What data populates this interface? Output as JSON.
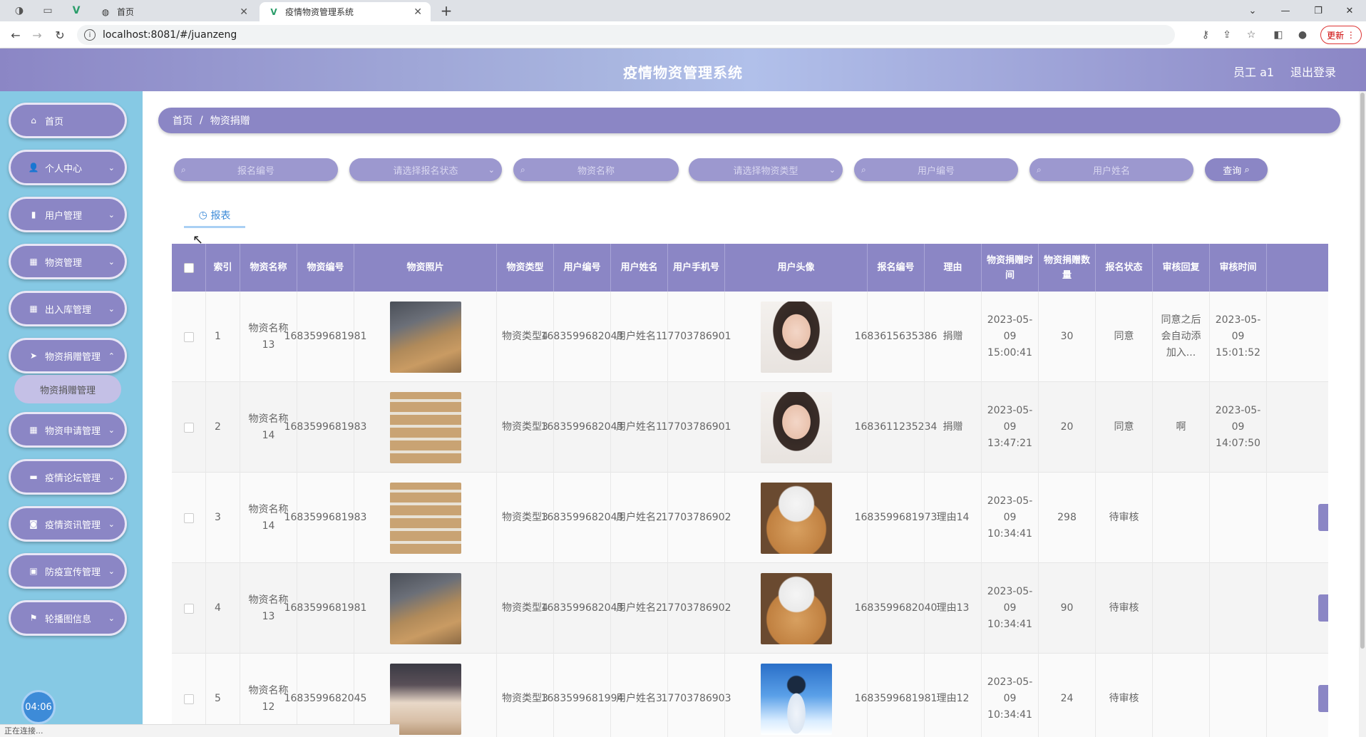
{
  "browser": {
    "tabs": [
      {
        "title": "首页",
        "active": false
      },
      {
        "title": "疫情物资管理系统",
        "active": true
      }
    ],
    "url": "localhost:8081/#/juanzeng",
    "update_label": "更新"
  },
  "header": {
    "title": "疫情物资管理系统",
    "user": "员工 a1",
    "logout": "退出登录"
  },
  "sidebar": {
    "items": [
      {
        "label": "首页",
        "icon": "home-icon"
      },
      {
        "label": "个人中心",
        "icon": "user-icon"
      },
      {
        "label": "用户管理",
        "icon": "chart-icon"
      },
      {
        "label": "物资管理",
        "icon": "grid-icon"
      },
      {
        "label": "出入库管理",
        "icon": "grid-icon"
      },
      {
        "label": "物资捐赠管理",
        "icon": "send-icon"
      },
      {
        "label": "物资申请管理",
        "icon": "grid-icon"
      },
      {
        "label": "疫情论坛管理",
        "icon": "tablet-icon"
      },
      {
        "label": "疫情资讯管理",
        "icon": "camera-icon"
      },
      {
        "label": "防疫宣传管理",
        "icon": "inbox-icon"
      },
      {
        "label": "轮播图信息",
        "icon": "flag-icon"
      }
    ],
    "submenu_label": "物资捐赠管理",
    "timer": "04:06"
  },
  "breadcrumb": {
    "home": "首页",
    "sep": "/",
    "current": "物资捐赠"
  },
  "filters": {
    "baoming_no": "报名编号",
    "baoming_status": "请选择报名状态",
    "wuzi_name": "物资名称",
    "wuzi_type": "请选择物资类型",
    "user_no": "用户编号",
    "user_name": "用户姓名",
    "query": "查询"
  },
  "report_tab": "报表",
  "table": {
    "headers": [
      "索引",
      "物资名称",
      "物资编号",
      "物资照片",
      "物资类型",
      "用户编号",
      "用户姓名",
      "用户手机号",
      "用户头像",
      "报名编号",
      "理由",
      "物资捐赠时间",
      "物资捐赠数量",
      "报名状态",
      "审核回复",
      "审核时间"
    ],
    "rows": [
      {
        "idx": "1",
        "name": "物资名称13",
        "no": "1683599681981",
        "type": "物资类型4",
        "uno": "1683599682043",
        "uname": "用户姓名1",
        "phone": "17703786901",
        "bno": "1683615635386",
        "reason": "捐赠",
        "time": "2023-05-09 15:00:41",
        "qty": "30",
        "status": "同意",
        "reply": "同意之后会自动添加入...",
        "rtime": "2023-05-09 15:01:52"
      },
      {
        "idx": "2",
        "name": "物资名称14",
        "no": "1683599681983",
        "type": "物资类型3",
        "uno": "1683599682043",
        "uname": "用户姓名1",
        "phone": "17703786901",
        "bno": "1683611235234",
        "reason": "捐赠",
        "time": "2023-05-09 13:47:21",
        "qty": "20",
        "status": "同意",
        "reply": "啊",
        "rtime": "2023-05-09 14:07:50"
      },
      {
        "idx": "3",
        "name": "物资名称14",
        "no": "1683599681983",
        "type": "物资类型3",
        "uno": "1683599682043",
        "uname": "用户姓名2",
        "phone": "17703786902",
        "bno": "1683599681973",
        "reason": "理由14",
        "time": "2023-05-09 10:34:41",
        "qty": "298",
        "status": "待审核",
        "reply": "",
        "rtime": ""
      },
      {
        "idx": "4",
        "name": "物资名称13",
        "no": "1683599681981",
        "type": "物资类型4",
        "uno": "1683599682043",
        "uname": "用户姓名2",
        "phone": "17703786902",
        "bno": "1683599682040",
        "reason": "理由13",
        "time": "2023-05-09 10:34:41",
        "qty": "90",
        "status": "待审核",
        "reply": "",
        "rtime": ""
      },
      {
        "idx": "5",
        "name": "物资名称12",
        "no": "1683599682045",
        "type": "物资类型3",
        "uno": "1683599681994",
        "uname": "用户姓名3",
        "phone": "17703786903",
        "bno": "1683599681981",
        "reason": "理由12",
        "time": "2023-05-09 10:34:41",
        "qty": "24",
        "status": "待审核",
        "reply": "",
        "rtime": ""
      }
    ]
  },
  "statusbar": "正在连接..."
}
